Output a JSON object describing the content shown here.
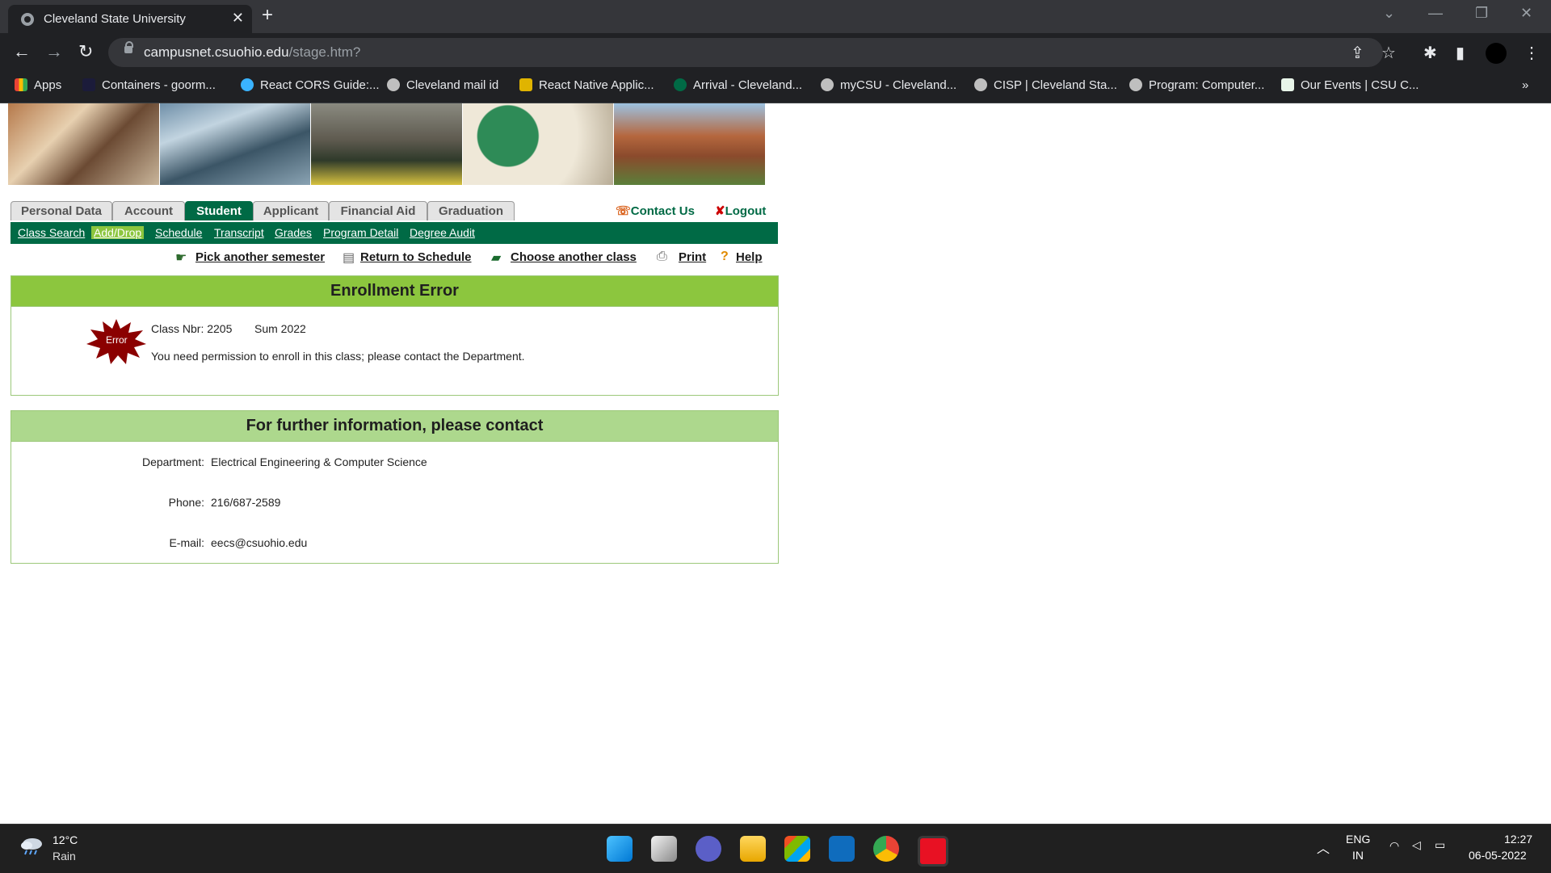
{
  "browser": {
    "tab_title": "Cleveland State University",
    "url_host": "campusnet.csuohio.edu",
    "url_path": "/stage.htm?",
    "bookmarks": [
      {
        "label": "Apps",
        "color": "#ea4335"
      },
      {
        "label": "Containers - goorm...",
        "color": "#1b1b3a"
      },
      {
        "label": "React CORS Guide:...",
        "color": "#3ab3ff"
      },
      {
        "label": "Cleveland mail id",
        "color": "#bfbfbf"
      },
      {
        "label": "React Native Applic...",
        "color": "#e0b400"
      },
      {
        "label": "Arrival - Cleveland...",
        "color": "#006a45"
      },
      {
        "label": "myCSU - Cleveland...",
        "color": "#bfbfbf"
      },
      {
        "label": "CISP | Cleveland Sta...",
        "color": "#bfbfbf"
      },
      {
        "label": "Program: Computer...",
        "color": "#bfbfbf"
      },
      {
        "label": "Our Events | CSU C...",
        "color": "#e8f5e9"
      }
    ]
  },
  "page": {
    "main_tabs": [
      "Personal Data",
      "Account",
      "Student",
      "Applicant",
      "Financial Aid",
      "Graduation"
    ],
    "active_tab": "Student",
    "contact_us": "Contact Us",
    "logout": "Logout",
    "sub_nav": [
      "Class Search",
      "Add/Drop",
      "Schedule",
      "Transcript",
      "Grades",
      "Program Detail",
      "Degree Audit"
    ],
    "active_sub": "Add/Drop",
    "actions": {
      "pick_semester": "Pick another semester",
      "return_schedule": "Return to Schedule",
      "choose_class": "Choose another class",
      "print": "Print",
      "help": "Help"
    },
    "error_box": {
      "title": "Enrollment Error",
      "icon_label": "Error",
      "class_nbr": "Class Nbr: 2205",
      "term": "Sum 2022",
      "message": "You need permission to enroll in this class; please contact the Department."
    },
    "contact_box": {
      "title": "For further information, please contact",
      "department_label": "Department:",
      "department": "Electrical Engineering & Computer Science",
      "phone_label": "Phone:",
      "phone": "216/687-2589",
      "email_label": "E-mail:",
      "email": "eecs@csuohio.edu"
    }
  },
  "taskbar": {
    "temperature": "12°C",
    "condition": "Rain",
    "lang1": "ENG",
    "lang2": "IN",
    "time": "12:27",
    "date": "06-05-2022"
  }
}
